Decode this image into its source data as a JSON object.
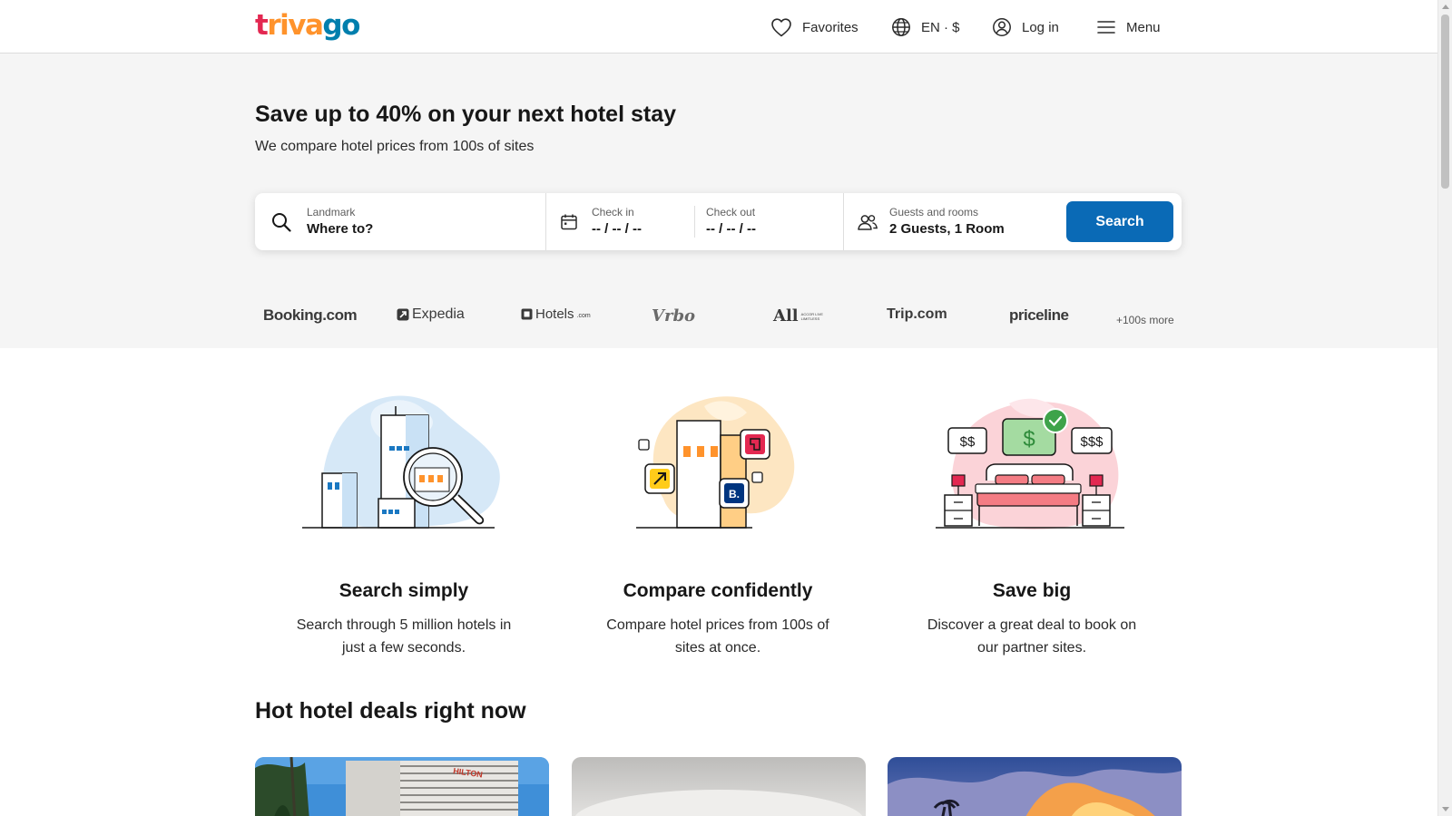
{
  "header": {
    "logo_parts": [
      "t",
      "riva",
      "go"
    ],
    "favorites_label": "Favorites",
    "locale_label": "EN · $",
    "login_label": "Log in",
    "menu_label": "Menu"
  },
  "hero": {
    "title": "Save up to 40% on your next hotel stay",
    "subtitle": "We compare hotel prices from 100s of sites"
  },
  "search": {
    "destination": {
      "caption": "Landmark",
      "value": "Where to?"
    },
    "check_in": {
      "caption": "Check in",
      "value": "-- / -- / --"
    },
    "check_out": {
      "caption": "Check out",
      "value": "-- / -- / --"
    },
    "guests": {
      "caption": "Guests and rooms",
      "value": "2 Guests, 1 Room"
    },
    "button_label": "Search"
  },
  "partners": {
    "items": [
      "Booking.com",
      "Expedia",
      "Hotels",
      ".com",
      "Vrbo",
      "All",
      "ACCOR LIVE LIMITLESS",
      "Trip.com",
      "priceline"
    ],
    "more_label": "+100s more"
  },
  "features": [
    {
      "title": "Search simply",
      "line1": "Search through 5 million hotels in",
      "line2": "just a few seconds."
    },
    {
      "title": "Compare confidently",
      "line1": "Compare hotel prices from 100s of",
      "line2": "sites at once."
    },
    {
      "title": "Save big",
      "line1": "Discover a great deal to book on",
      "line2": "our partner sites."
    }
  ],
  "illustration_labels": {
    "brand_b": "B.",
    "price_low": "$$",
    "price_mid": "$",
    "price_high": "$$$",
    "hotel_sign": "HILTON"
  },
  "deals": {
    "title": "Hot hotel deals right now"
  },
  "colors": {
    "brand_red": "#e32851",
    "brand_orange": "#ff932c",
    "brand_blue": "#007fad",
    "search_button": "#0a6ab6"
  },
  "icons": [
    "heart-icon",
    "globe-icon",
    "user-icon",
    "menu-icon",
    "search-icon",
    "calendar-icon",
    "guests-icon"
  ]
}
